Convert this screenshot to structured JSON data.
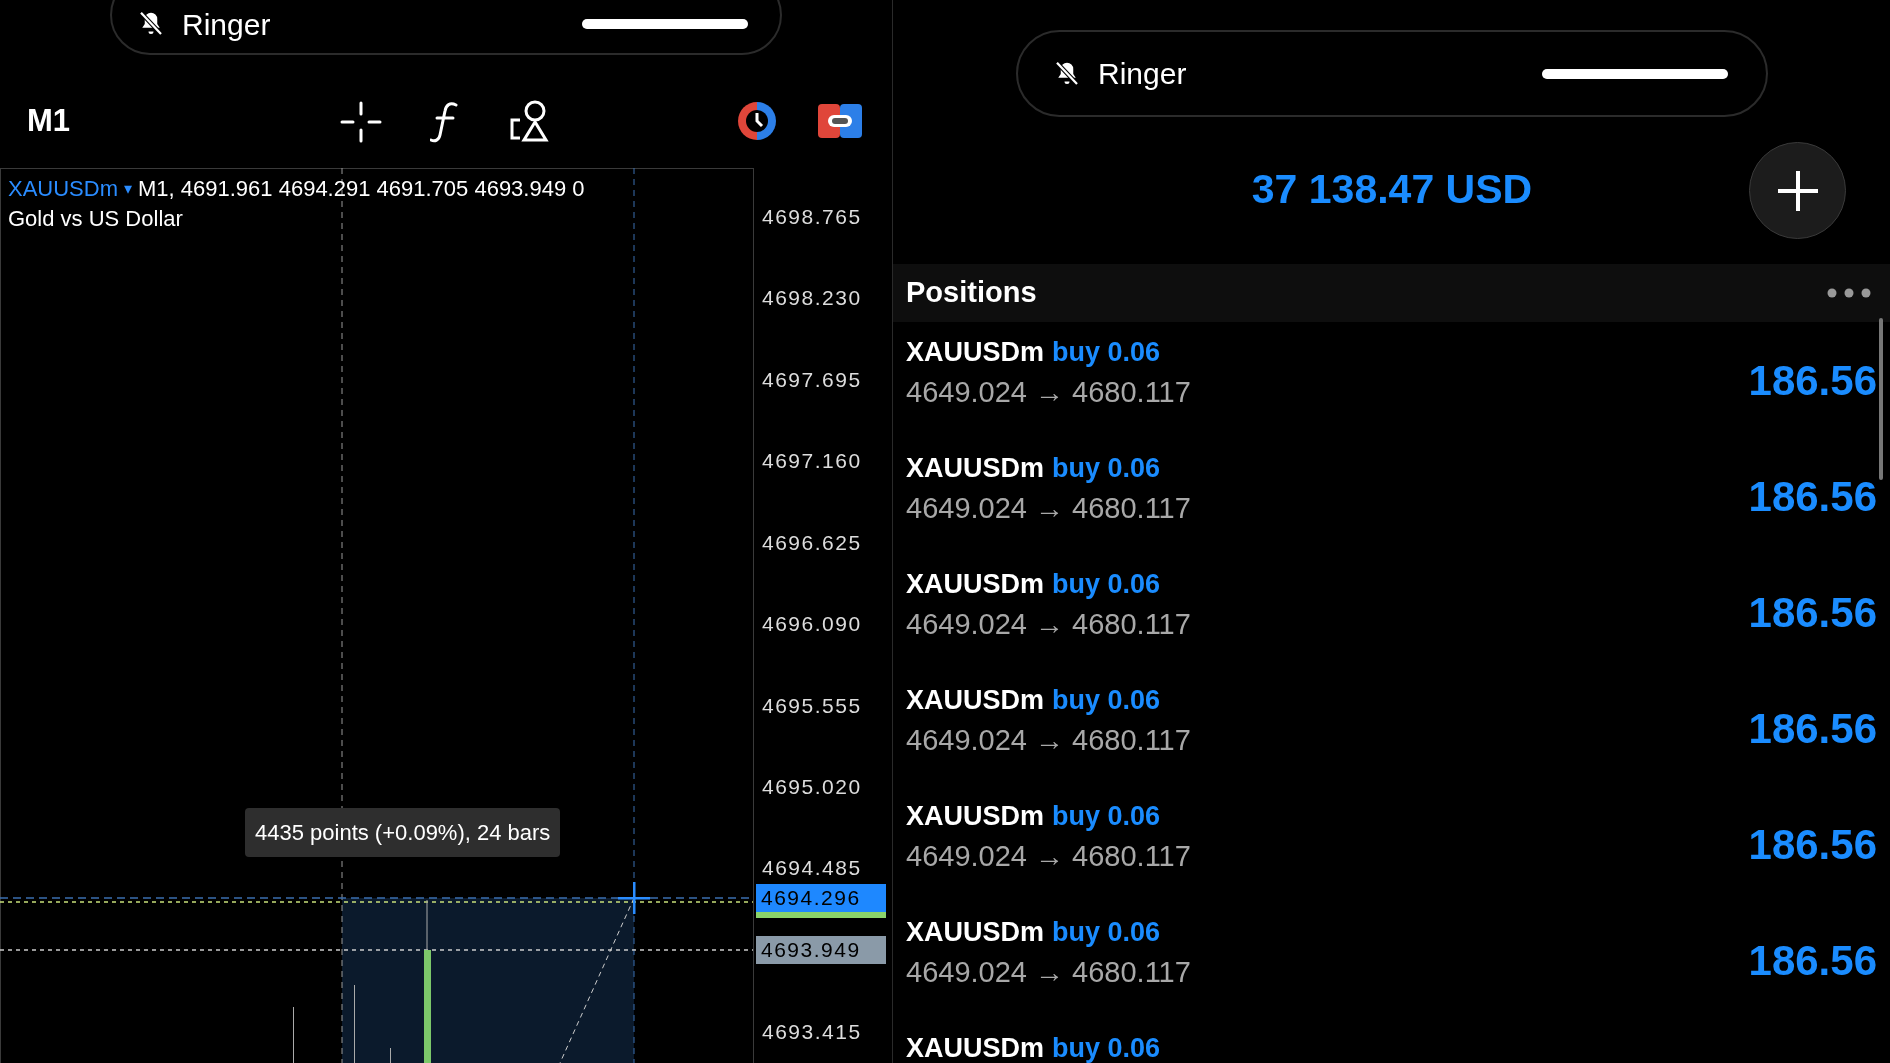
{
  "left_phone": {
    "ringer": {
      "label": "Ringer",
      "level": 1
    },
    "toolbar": {
      "timeframe": "M1"
    },
    "chart": {
      "symbol": "XAUUSDm",
      "symbol_caret": "▾",
      "ohlc": "M1, 4691.961 4694.291 4691.705 4693.949 0",
      "description": "Gold vs US Dollar",
      "price_labels": [
        "4698.765",
        "4698.230",
        "4697.695",
        "4697.160",
        "4696.625",
        "4696.090",
        "4695.555",
        "4695.020",
        "4694.485",
        "4693.415"
      ],
      "bid_tag": "4694.296",
      "last_tag": "4693.949",
      "measure_tooltip": "4435 points (+0.09%), 24 bars"
    }
  },
  "right_phone": {
    "ringer": {
      "label": "Ringer",
      "level": 1
    },
    "balance": "37 138.47 USD",
    "positions": {
      "title": "Positions",
      "rows": [
        {
          "symbol": "XAUUSDm",
          "side": "buy 0.06",
          "prices": "4649.024 → 4680.117",
          "profit": "186.56"
        },
        {
          "symbol": "XAUUSDm",
          "side": "buy 0.06",
          "prices": "4649.024 → 4680.117",
          "profit": "186.56"
        },
        {
          "symbol": "XAUUSDm",
          "side": "buy 0.06",
          "prices": "4649.024 → 4680.117",
          "profit": "186.56"
        },
        {
          "symbol": "XAUUSDm",
          "side": "buy 0.06",
          "prices": "4649.024 → 4680.117",
          "profit": "186.56"
        },
        {
          "symbol": "XAUUSDm",
          "side": "buy 0.06",
          "prices": "4649.024 → 4680.117",
          "profit": "186.56"
        },
        {
          "symbol": "XAUUSDm",
          "side": "buy 0.06",
          "prices": "4649.024 → 4680.117",
          "profit": "186.56"
        },
        {
          "symbol": "XAUUSDm",
          "side": "buy 0.06"
        }
      ]
    }
  }
}
